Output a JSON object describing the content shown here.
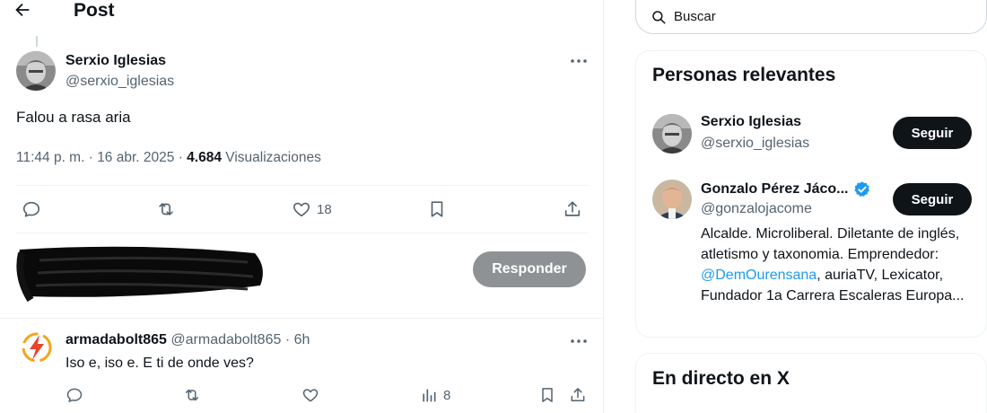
{
  "header": {
    "title": "Post"
  },
  "post": {
    "author_name": "Serxio Iglesias",
    "author_handle": "@serxio_iglesias",
    "text": "Falou a rasa aria",
    "time": "11:44 p. m.",
    "sep1": " · ",
    "date": "16 abr. 2025",
    "sep2": " · ",
    "views_count": "4.684",
    "views_label": "Visualizaciones",
    "actions": {
      "like_count": "18"
    }
  },
  "composer": {
    "reply_button": "Responder"
  },
  "reply": {
    "author_name": "armadabolt865",
    "author_handle": "@armadabolt865",
    "sep": " · ",
    "time": "6h",
    "text": "Iso e, iso e. E ti de onde ves?",
    "views_count": "8"
  },
  "sidebar": {
    "search_placeholder": "Buscar",
    "relevant": {
      "title": "Personas relevantes",
      "people": [
        {
          "name": "Serxio Iglesias",
          "handle": "@serxio_iglesias",
          "button": "Seguir"
        },
        {
          "name": "Gonzalo Pérez Jáco...",
          "handle": "@gonzalojacome",
          "button": "Seguir",
          "bio_1": "Alcalde. Microliberal. Diletante de inglés, atletismo y taxonomia. Emprendedor: ",
          "bio_link": "@DemOurensana",
          "bio_2": ", auriaTV, Lexicator, Fundador 1a Carrera Escaleras Europa..."
        }
      ]
    },
    "live": {
      "title": "En directo en X"
    }
  },
  "colors": {
    "accent": "#1d9bf0",
    "text": "#0f1419",
    "muted": "#536471",
    "verified": "#1d9bf0"
  }
}
